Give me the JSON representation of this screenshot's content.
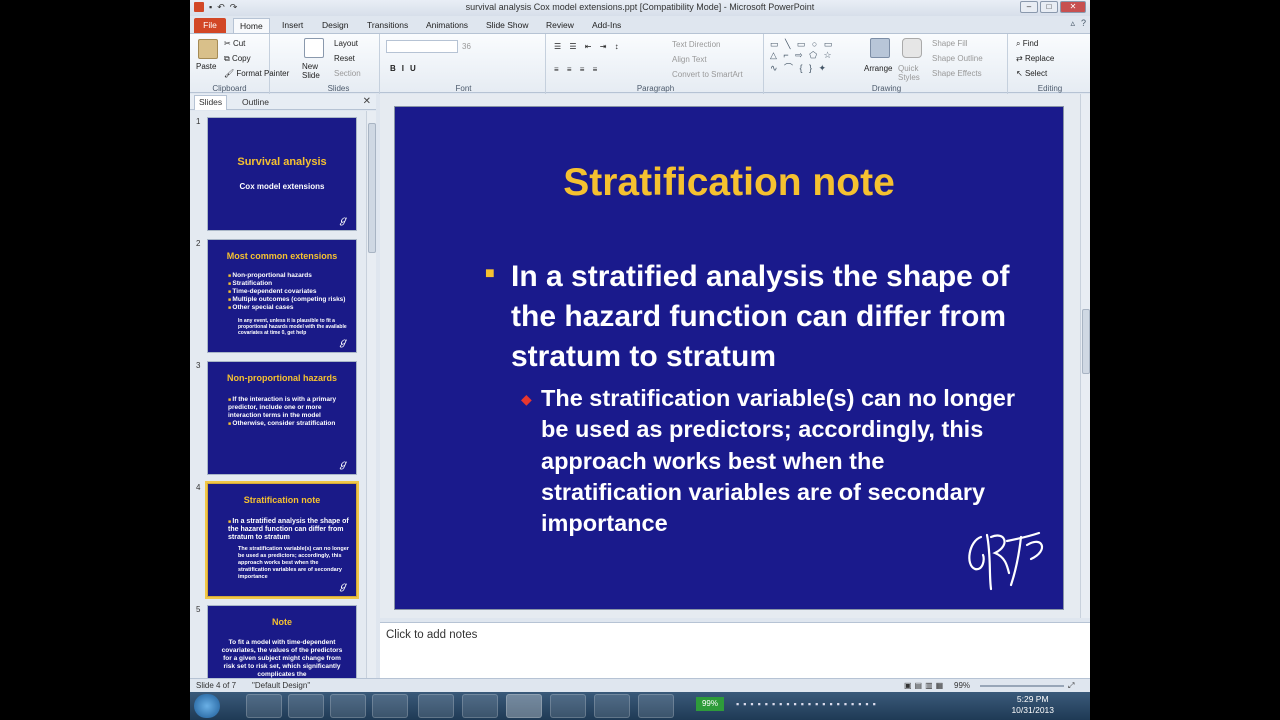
{
  "window": {
    "title": "survival analysis Cox model extensions.ppt [Compatibility Mode] - Microsoft PowerPoint"
  },
  "tabs": [
    "File",
    "Home",
    "Insert",
    "Design",
    "Transitions",
    "Animations",
    "Slide Show",
    "Review",
    "Add-Ins"
  ],
  "ribbon": {
    "clipboard": {
      "label": "Clipboard",
      "paste": "Paste",
      "cut": "Cut",
      "copy": "Copy",
      "format_painter": "Format Painter"
    },
    "slides": {
      "label": "Slides",
      "new_slide": "New Slide",
      "layout": "Layout",
      "reset": "Reset",
      "section": "Section"
    },
    "font": {
      "label": "Font",
      "size": "36"
    },
    "paragraph": {
      "label": "Paragraph",
      "text_direction": "Text Direction",
      "align_text": "Align Text",
      "convert_smartart": "Convert to SmartArt"
    },
    "drawing": {
      "label": "Drawing",
      "arrange": "Arrange",
      "quick_styles": "Quick Styles",
      "shape_fill": "Shape Fill",
      "shape_outline": "Shape Outline",
      "shape_effects": "Shape Effects"
    },
    "editing": {
      "label": "Editing",
      "find": "Find",
      "replace": "Replace",
      "select": "Select"
    }
  },
  "panel": {
    "tab_slides": "Slides",
    "tab_outline": "Outline"
  },
  "thumbnails": [
    {
      "num": "1",
      "title": "Survival analysis",
      "subtitle": "Cox model extensions"
    },
    {
      "num": "2",
      "title": "Most common extensions",
      "bullets": [
        "Non-proportional hazards",
        "Stratification",
        "Time-dependent covariates",
        "Multiple outcomes (competing risks)",
        "Other special cases"
      ],
      "sub": "In any event, unless it is plausible to fit a proportional hazards model with the available covariates at time 0, get help"
    },
    {
      "num": "3",
      "title": "Non-proportional hazards",
      "bullets": [
        "If the interaction is with a primary predictor, include one or more interaction terms in the model",
        "Otherwise, consider stratification"
      ]
    },
    {
      "num": "4",
      "title": "Stratification note",
      "bullets": [
        "In a stratified analysis the shape of the hazard function can differ from stratum to stratum"
      ],
      "sub": "The stratification variable(s) can no longer be used as predictors; accordingly, this approach works best when the stratification variables are of secondary importance"
    },
    {
      "num": "5",
      "title": "Note",
      "body": "To fit a model with time-dependent covariates, the values of the predictors for a given subject might change from risk set to risk set, which significantly complicates the"
    }
  ],
  "slide": {
    "title": "Stratification note",
    "bullet": "In a stratified analysis the shape of the hazard function can differ from stratum to stratum",
    "sub_bullet": "The stratification variable(s) can no longer be used as predictors; accordingly, this approach works best when the stratification variables are of secondary importance",
    "signature": "GRTP"
  },
  "notes_placeholder": "Click to add notes",
  "status": {
    "slide_of": "Slide 4 of 7",
    "theme": "\"Default Design\"",
    "zoom": "99%"
  },
  "taskbar": {
    "time": "5:29 PM",
    "date": "10/31/2013",
    "battery": "99%"
  }
}
